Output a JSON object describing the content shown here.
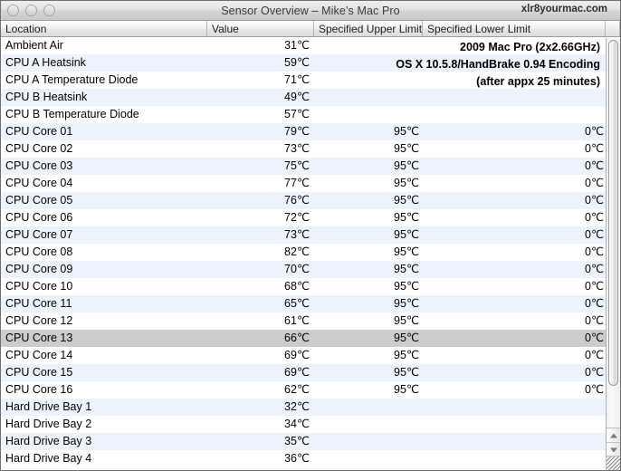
{
  "window": {
    "title": "Sensor Overview – Mike’s Mac Pro",
    "site_tag": "xlr8yourmac.com",
    "controls": {
      "close_label": "",
      "minimize_label": "",
      "zoom_label": ""
    }
  },
  "table": {
    "columns": {
      "location": "Location",
      "value": "Value",
      "upper": "Specified Upper Limit",
      "lower": "Specified Lower Limit"
    },
    "rows": [
      {
        "location": "Ambient Air",
        "value": "31℃",
        "upper": "",
        "lower": "",
        "selected": false
      },
      {
        "location": "CPU A Heatsink",
        "value": "59℃",
        "upper": "",
        "lower": "",
        "selected": false
      },
      {
        "location": "CPU A Temperature Diode",
        "value": "71℃",
        "upper": "",
        "lower": "",
        "selected": false
      },
      {
        "location": "CPU B Heatsink",
        "value": "49℃",
        "upper": "",
        "lower": "",
        "selected": false
      },
      {
        "location": "CPU B Temperature Diode",
        "value": "57℃",
        "upper": "",
        "lower": "",
        "selected": false
      },
      {
        "location": "CPU Core 01",
        "value": "79℃",
        "upper": "95℃",
        "lower": "0℃",
        "selected": false
      },
      {
        "location": "CPU Core 02",
        "value": "73℃",
        "upper": "95℃",
        "lower": "0℃",
        "selected": false
      },
      {
        "location": "CPU Core 03",
        "value": "75℃",
        "upper": "95℃",
        "lower": "0℃",
        "selected": false
      },
      {
        "location": "CPU Core 04",
        "value": "77℃",
        "upper": "95℃",
        "lower": "0℃",
        "selected": false
      },
      {
        "location": "CPU Core 05",
        "value": "76℃",
        "upper": "95℃",
        "lower": "0℃",
        "selected": false
      },
      {
        "location": "CPU Core 06",
        "value": "72℃",
        "upper": "95℃",
        "lower": "0℃",
        "selected": false
      },
      {
        "location": "CPU Core 07",
        "value": "73℃",
        "upper": "95℃",
        "lower": "0℃",
        "selected": false
      },
      {
        "location": "CPU Core 08",
        "value": "82℃",
        "upper": "95℃",
        "lower": "0℃",
        "selected": false
      },
      {
        "location": "CPU Core 09",
        "value": "70℃",
        "upper": "95℃",
        "lower": "0℃",
        "selected": false
      },
      {
        "location": "CPU Core 10",
        "value": "68℃",
        "upper": "95℃",
        "lower": "0℃",
        "selected": false
      },
      {
        "location": "CPU Core 11",
        "value": "65℃",
        "upper": "95℃",
        "lower": "0℃",
        "selected": false
      },
      {
        "location": "CPU Core 12",
        "value": "61℃",
        "upper": "95℃",
        "lower": "0℃",
        "selected": false
      },
      {
        "location": "CPU Core 13",
        "value": "66℃",
        "upper": "95℃",
        "lower": "0℃",
        "selected": true
      },
      {
        "location": "CPU Core 14",
        "value": "69℃",
        "upper": "95℃",
        "lower": "0℃",
        "selected": false
      },
      {
        "location": "CPU Core 15",
        "value": "69℃",
        "upper": "95℃",
        "lower": "0℃",
        "selected": false
      },
      {
        "location": "CPU Core 16",
        "value": "62℃",
        "upper": "95℃",
        "lower": "0℃",
        "selected": false
      },
      {
        "location": "Hard Drive Bay 1",
        "value": "32℃",
        "upper": "",
        "lower": "",
        "selected": false
      },
      {
        "location": "Hard Drive Bay 2",
        "value": "34℃",
        "upper": "",
        "lower": "",
        "selected": false
      },
      {
        "location": "Hard Drive Bay 3",
        "value": "35℃",
        "upper": "",
        "lower": "",
        "selected": false
      },
      {
        "location": "Hard Drive Bay 4",
        "value": "36℃",
        "upper": "",
        "lower": "",
        "selected": false
      }
    ]
  },
  "annotation": {
    "line1": "2009 Mac Pro (2x2.66GHz)",
    "line2": "OS X 10.5.8/HandBrake 0.94 Encoding",
    "line3": "(after appx 25 minutes)"
  },
  "scrollbar": {
    "up_arrow": "▲",
    "down_arrow": "▼"
  }
}
